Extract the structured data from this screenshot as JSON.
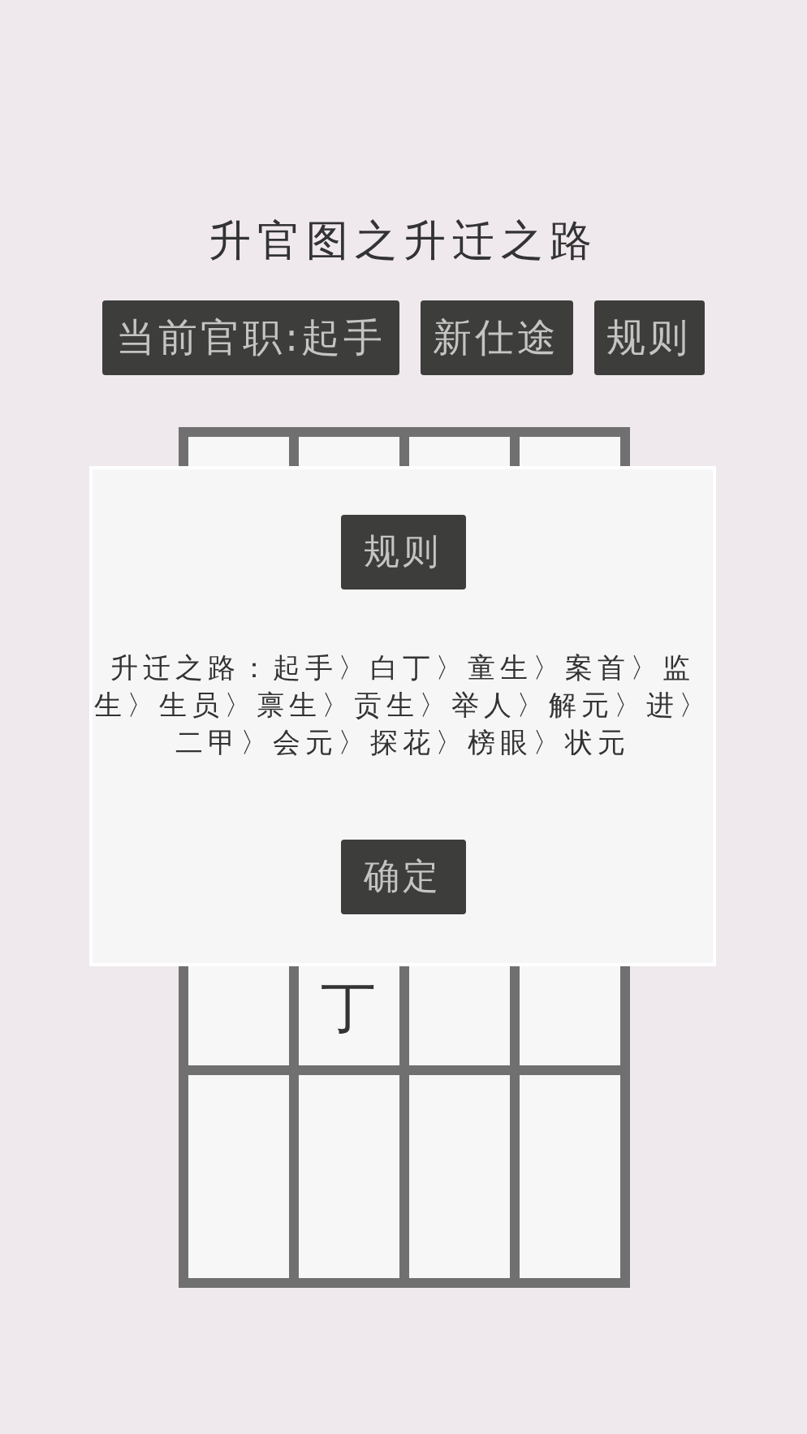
{
  "title": "升官图之升迁之路",
  "buttons": [
    {
      "label": "当前官职:起手"
    },
    {
      "label": "新仕途"
    },
    {
      "label": "规则"
    }
  ],
  "board": {
    "rows": [
      {
        "cells": [
          {},
          {},
          {},
          {}
        ]
      },
      {
        "cells": [
          {},
          {},
          {},
          {}
        ]
      },
      {
        "cells": [
          {},
          {
            "text": "丁"
          },
          {},
          {}
        ]
      },
      {
        "cells": [
          {},
          {},
          {},
          {}
        ]
      }
    ]
  },
  "dialog": {
    "title": "规则",
    "message": "升迁之路：起手〉白丁〉童生〉案首〉监生〉生员〉禀生〉贡生〉举人〉解元〉进〉二甲〉会元〉探花〉榜眼〉状元",
    "confirm": "确定"
  }
}
